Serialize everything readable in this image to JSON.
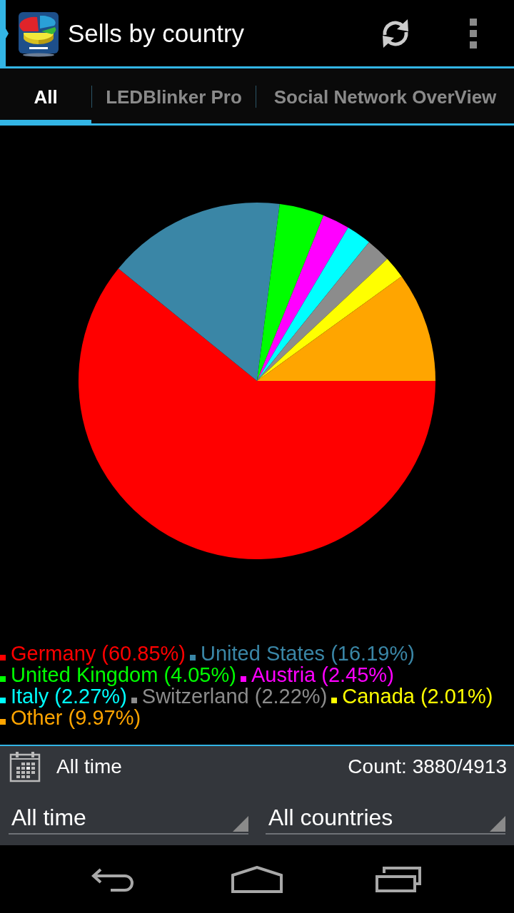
{
  "action_bar": {
    "title": "Sells by country"
  },
  "tabs": [
    {
      "label": "All",
      "selected": true
    },
    {
      "label": "LEDBlinker Pro",
      "selected": false
    },
    {
      "label": "Social Network OverView",
      "selected": false
    }
  ],
  "chart": {
    "chart_data": {
      "type": "pie",
      "categories": [
        "Germany",
        "United States",
        "United Kingdom",
        "Austria",
        "Italy",
        "Switzerland",
        "Canada",
        "Other"
      ],
      "values": [
        60.85,
        16.19,
        4.05,
        2.45,
        2.27,
        2.22,
        2.01,
        9.97
      ],
      "value_labels": [
        "(60.85%)",
        "(16.19%)",
        "(4.05%)",
        "(2.45%)",
        "(2.27%)",
        "(2.22%)",
        "(2.01%)",
        "(9.97%)"
      ]
    },
    "legend": [
      {
        "color": "#ff0000"
      },
      {
        "color": "#3a86a6"
      },
      {
        "color": "#00ff00"
      },
      {
        "color": "#ff00ff"
      },
      {
        "color": "#00ffff"
      },
      {
        "color": "#8c8c8c"
      },
      {
        "color": "#ffff00"
      },
      {
        "color": "#ffa500"
      }
    ]
  },
  "summary": {
    "period": "All time",
    "count": "Count: 3880/4913"
  },
  "filters": [
    {
      "value": "All time"
    },
    {
      "value": "All countries"
    }
  ]
}
